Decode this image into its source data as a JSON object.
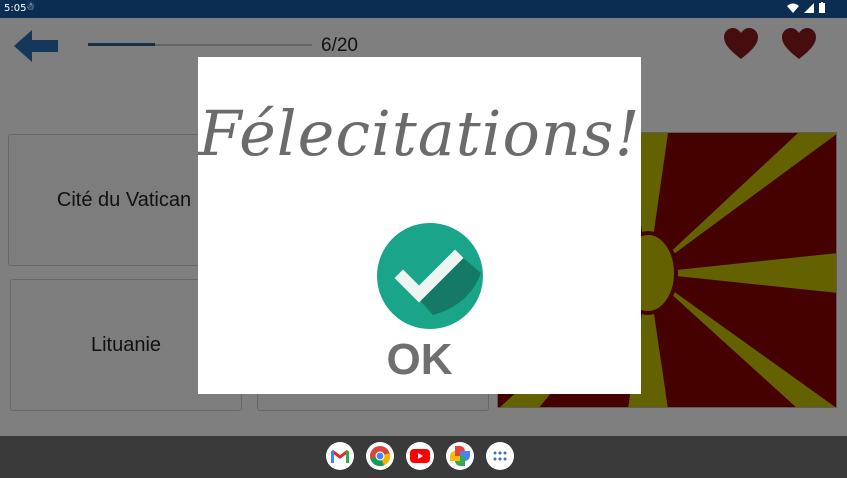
{
  "status": {
    "time": "5:05",
    "sim_icon": "sim-icon"
  },
  "game": {
    "progress_text": "6/20",
    "progress_fraction": 0.3,
    "choices": [
      "Cité du Vatican",
      "Lituanie",
      ""
    ]
  },
  "dialog": {
    "title": "Félecitations!",
    "ok_label": "OK"
  },
  "colors": {
    "heart": "#8b1a1a",
    "arrow": "#2a6fb5",
    "check_bg": "#1aa58a",
    "check_shadow": "#147a65",
    "flag_red": "#8a0000",
    "flag_yellow": "#c9c400",
    "status_bar": "#0b2d52"
  },
  "dock": [
    {
      "icon": "gmail-icon"
    },
    {
      "icon": "chrome-icon"
    },
    {
      "icon": "youtube-icon"
    },
    {
      "icon": "photos-icon"
    },
    {
      "icon": "app-drawer-icon"
    }
  ]
}
